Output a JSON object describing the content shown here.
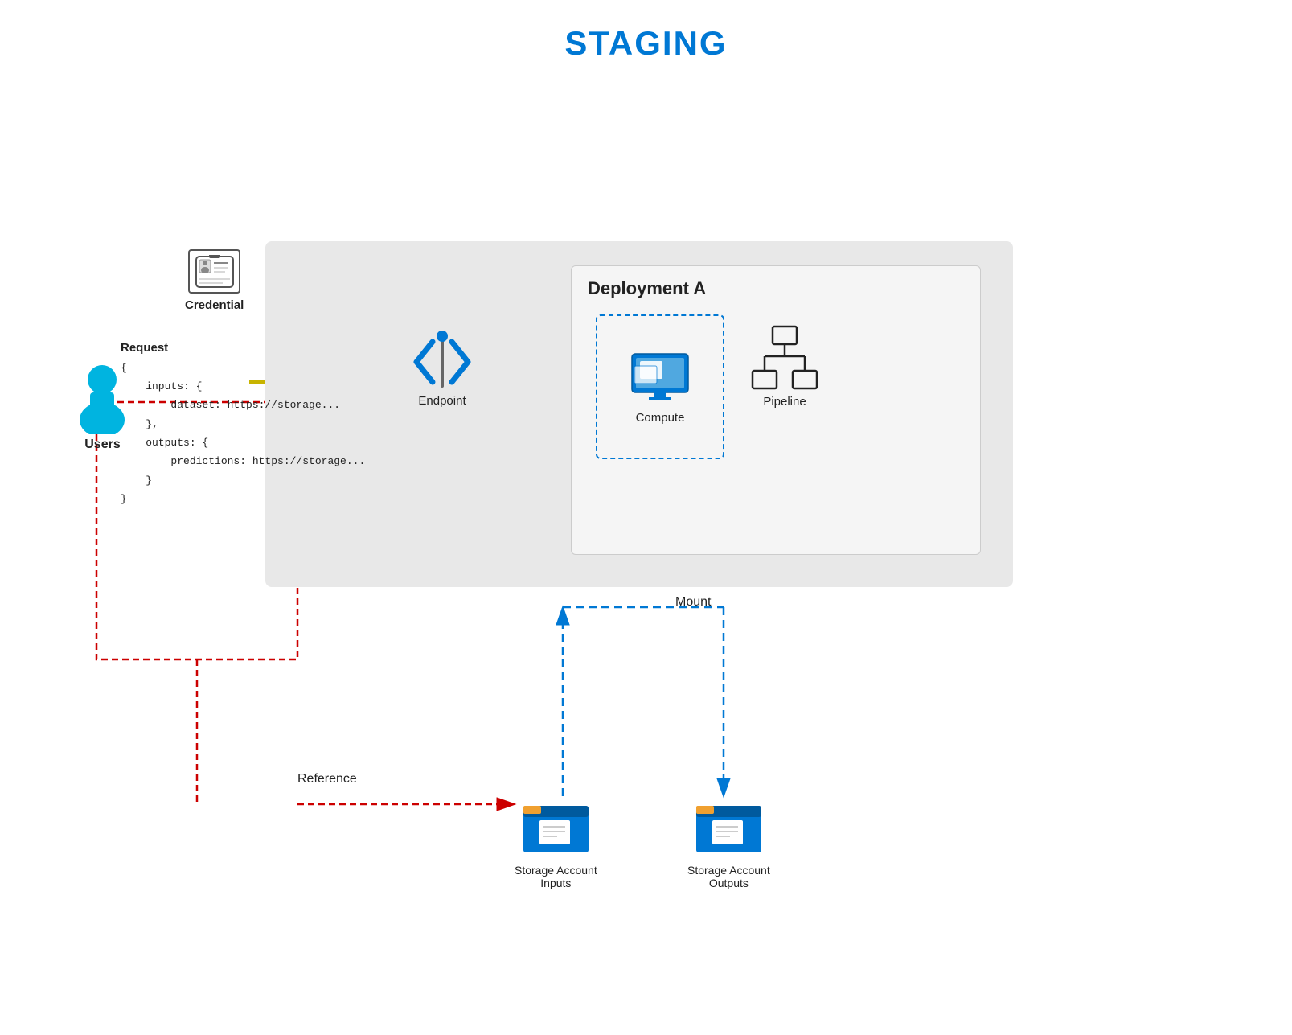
{
  "title": "STAGING",
  "diagram": {
    "deployment_label": "Deployment A",
    "users_label": "Users",
    "credential_label": "Credential",
    "endpoint_label": "Endpoint",
    "compute_label": "Compute",
    "pipeline_label": "Pipeline",
    "mount_label": "Mount",
    "reference_label": "Reference",
    "storage_inputs_label": "Storage Account\nInputs",
    "storage_inputs_line1": "Storage Account",
    "storage_inputs_line2": "Inputs",
    "storage_outputs_line1": "Storage Account",
    "storage_outputs_line2": "Outputs",
    "request_text": "Request\n{\n    inputs: {\n        dataset: https://storage...\n    },\n    outputs: {\n        predictions: https://storage...\n    }\n}"
  }
}
